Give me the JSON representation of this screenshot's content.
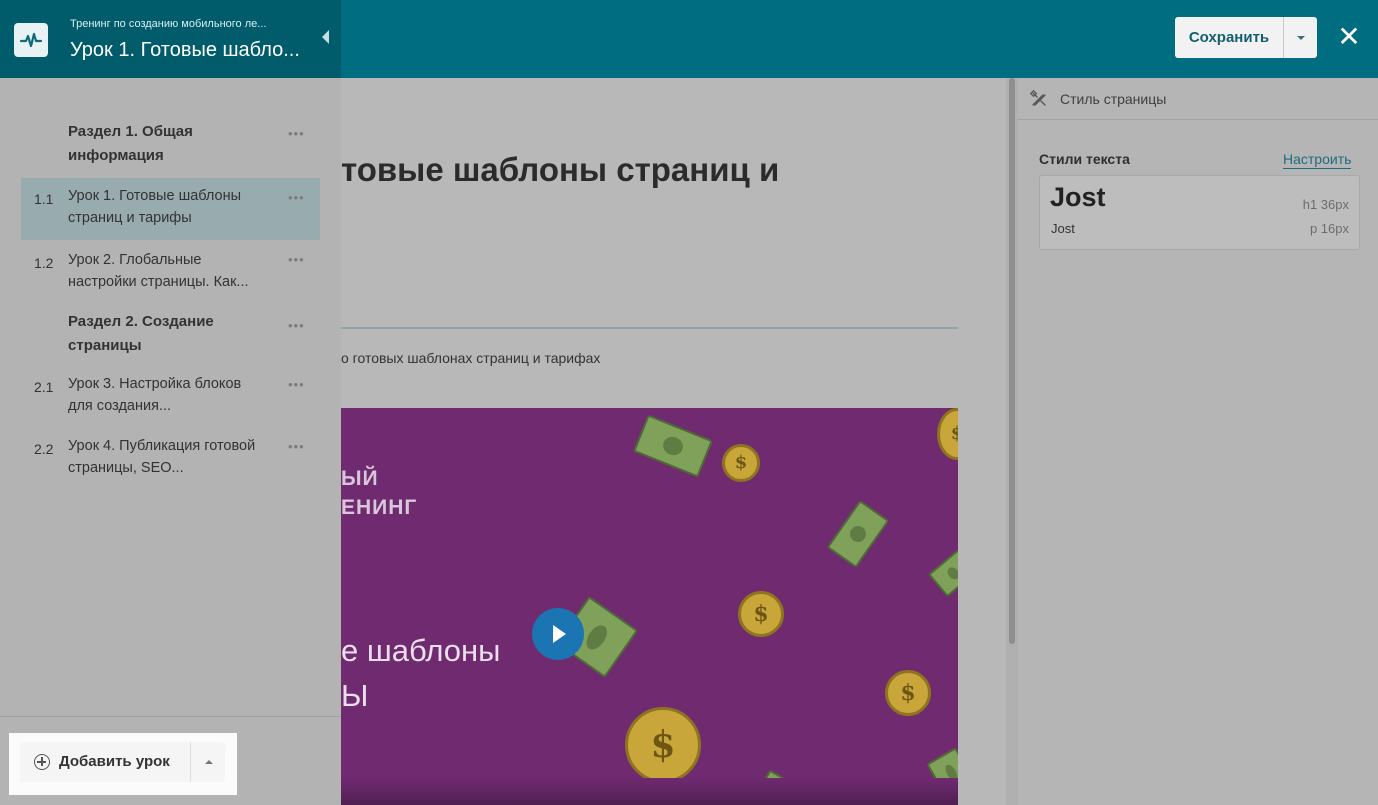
{
  "header": {
    "course_title": "Тренинг по созданию мобильного ле...",
    "lesson_title": "Урок 1. Готовые шабло...",
    "save_label": "Сохранить",
    "close_label": "✕"
  },
  "sidebar": {
    "items": [
      {
        "type": "section",
        "num": "",
        "label": "Раздел 1. Общая информация",
        "active": false
      },
      {
        "type": "lesson",
        "num": "1.1",
        "label": "Урок 1. Готовые шаблоны страниц и тарифы",
        "active": true
      },
      {
        "type": "lesson",
        "num": "1.2",
        "label": "Урок 2. Глобальные настройки страницы. Как...",
        "active": false
      },
      {
        "type": "section",
        "num": "",
        "label": "Раздел 2. Создание страницы",
        "active": false
      },
      {
        "type": "lesson",
        "num": "2.1",
        "label": "Урок 3. Настройка блоков для создания...",
        "active": false
      },
      {
        "type": "lesson",
        "num": "2.2",
        "label": "Урок 4. Публикация готовой страницы, SEO...",
        "active": false
      }
    ],
    "more_label": "•••",
    "add_lesson_label": "Добавить урок"
  },
  "content": {
    "heading_visible": "товые шаблоны страниц и",
    "description_visible": "о готовых шаблонах страниц и тарифах",
    "video": {
      "subtitle_visible": "ЫЙ\nЕНИНГ",
      "title_visible": "е шаблоны\nЫ",
      "coin_symbol": "$"
    }
  },
  "right_panel": {
    "title": "Стиль страницы",
    "styles_label": "Стили текста",
    "configure_label": "Настроить",
    "font_preview_big": "Jost",
    "font_preview_small": "Jost",
    "h1_size": "h1  36px",
    "p_size": "p  16px"
  },
  "colors": {
    "topbar": "#006d80",
    "topbar_left": "#005b6b",
    "overlay_grey": "#b8b8b8",
    "active_item": "#98abae",
    "video_bg": "#702a70",
    "play_button": "#1a75b2",
    "link": "#1f6b82"
  }
}
